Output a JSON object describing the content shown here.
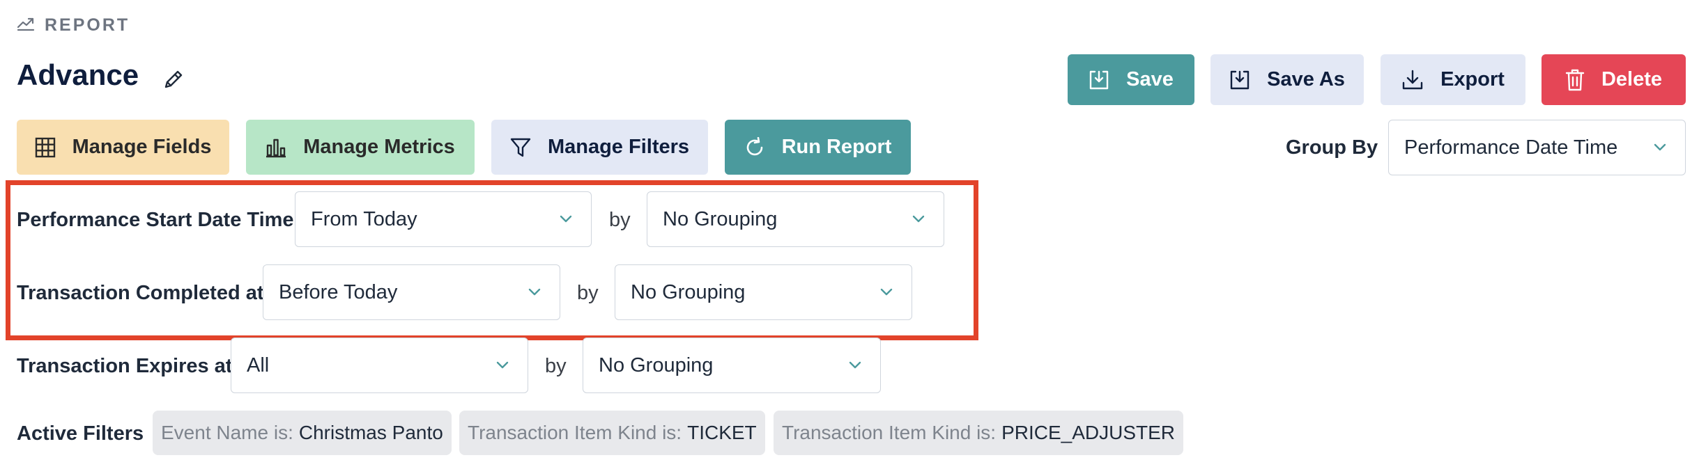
{
  "header": {
    "section_label": "REPORT",
    "title": "Advance"
  },
  "actions": {
    "save": "Save",
    "save_as": "Save As",
    "export": "Export",
    "delete": "Delete"
  },
  "toolbar": {
    "manage_fields": "Manage Fields",
    "manage_metrics": "Manage Metrics",
    "manage_filters": "Manage Filters",
    "run_report": "Run Report"
  },
  "group_by": {
    "label": "Group By",
    "value": "Performance Date Time"
  },
  "date_filters": [
    {
      "label": "Performance Start Date Time",
      "range": "From Today",
      "by": "by",
      "grouping": "No Grouping"
    },
    {
      "label": "Transaction Completed at",
      "range": "Before Today",
      "by": "by",
      "grouping": "No Grouping"
    },
    {
      "label": "Transaction Expires at",
      "range": "All",
      "by": "by",
      "grouping": "No Grouping"
    }
  ],
  "active_filters": {
    "label": "Active Filters",
    "chips": [
      {
        "key": "Event Name is:",
        "value": "Christmas Panto"
      },
      {
        "key": "Transaction Item Kind is:",
        "value": "TICKET"
      },
      {
        "key": "Transaction Item Kind is:",
        "value": "PRICE_ADJUSTER"
      }
    ]
  },
  "colors": {
    "teal": "#4b9a9d",
    "light_blue": "#e3e8f5",
    "red": "#e54656",
    "peach": "#f9dfb0",
    "mint": "#b7e6c7",
    "highlight": "#e2432a"
  }
}
